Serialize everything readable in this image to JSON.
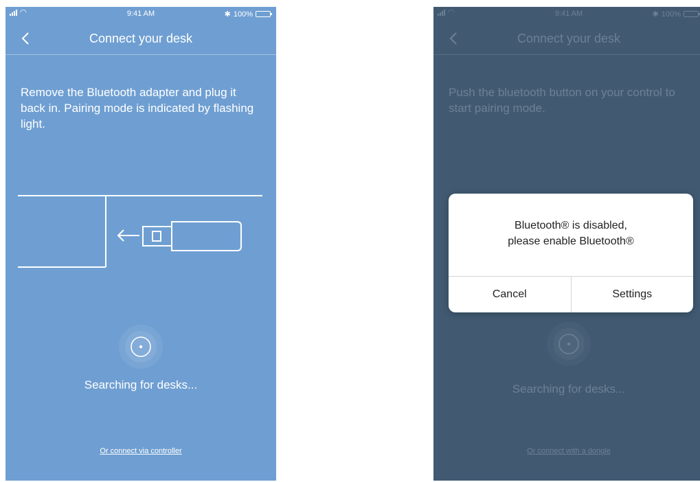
{
  "colors": {
    "left_background": "#6f9fd2",
    "right_background": "#415a72",
    "dialog_background": "#ffffff"
  },
  "left_screen": {
    "status_bar": {
      "time": "9:41 AM",
      "battery": "100%",
      "icons": [
        "signal-icon",
        "wifi-icon",
        "bluetooth-icon",
        "battery-icon"
      ]
    },
    "nav": {
      "back_icon": "chevron-left-icon",
      "title": "Connect your desk"
    },
    "instruction": "Remove the Bluetooth adapter and plug it back in. Pairing mode is indicated by flashing light.",
    "illustration_icon": "usb-adapter-icon",
    "searching_text": "Searching for desks...",
    "alt_link": "Or connect via controller"
  },
  "right_screen": {
    "status_bar": {
      "time": "9:41 AM",
      "battery": "100%",
      "icons": [
        "signal-icon",
        "wifi-icon",
        "bluetooth-icon",
        "battery-icon"
      ]
    },
    "nav": {
      "back_icon": "chevron-left-icon",
      "title": "Connect your desk"
    },
    "instruction": "Push the bluetooth button on your control to start pairing mode.",
    "searching_text": "Searching for desks...",
    "alt_link": "Or connect with a dongle",
    "dialog": {
      "message_line1": "Bluetooth® is disabled,",
      "message_line2": "please enable Bluetooth®",
      "cancel_label": "Cancel",
      "settings_label": "Settings"
    }
  }
}
